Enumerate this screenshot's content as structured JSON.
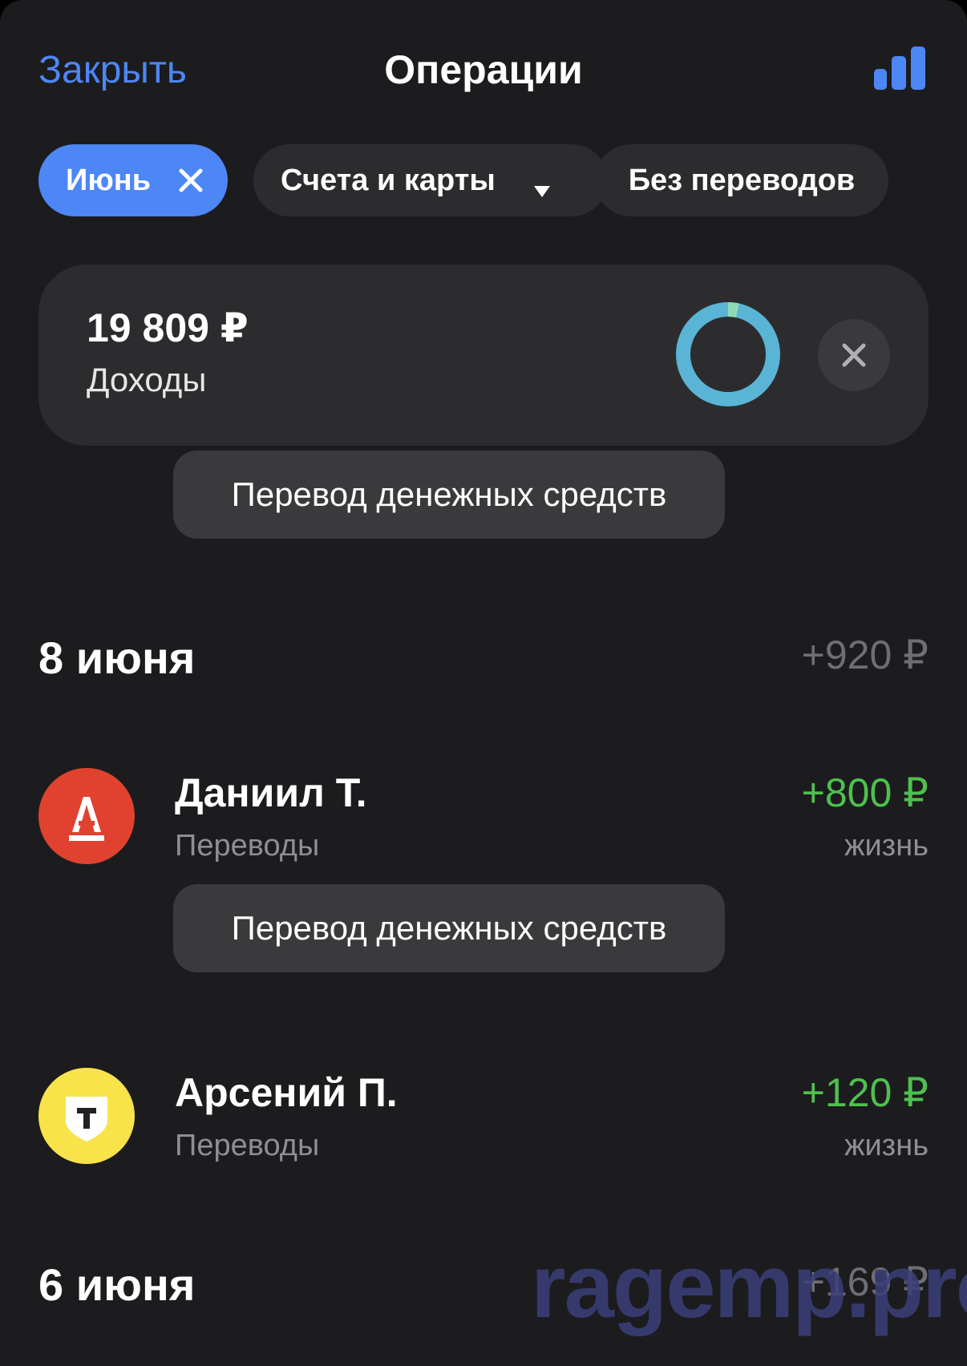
{
  "nav": {
    "close_label": "Закрыть",
    "title": "Операции",
    "stats_icon": "bar-chart-icon"
  },
  "filters": {
    "month": "Июнь",
    "accounts": "Счета и карты",
    "transfers": "Без переводов"
  },
  "summary": {
    "amount": "19 809 ₽",
    "label": "Доходы",
    "donut_colors": {
      "main": "#5ab4d6",
      "segment": "#8fd9b4"
    }
  },
  "category_tag_1": "Перевод денежных средств",
  "days": [
    {
      "date": "8 июня",
      "total": "+920 ₽"
    },
    {
      "date": "6 июня",
      "total": "+169 ₽"
    }
  ],
  "operations": [
    {
      "name": "Даниил Т.",
      "category": "Переводы",
      "amount": "+800 ₽",
      "account": "жизнь",
      "avatar_icon": "alfa-bank-icon",
      "avatar_color": "#e0422f",
      "tag": "Перевод денежных средств"
    },
    {
      "name": "Арсений П.",
      "category": "Переводы",
      "amount": "+120 ₽",
      "account": "жизнь",
      "avatar_icon": "tinkoff-bank-icon",
      "avatar_color": "#f8e34a"
    }
  ],
  "watermark": "ragemp.pro",
  "colors": {
    "accent": "#4d86f5",
    "positive": "#4fc04f",
    "background": "#1c1c1e"
  }
}
